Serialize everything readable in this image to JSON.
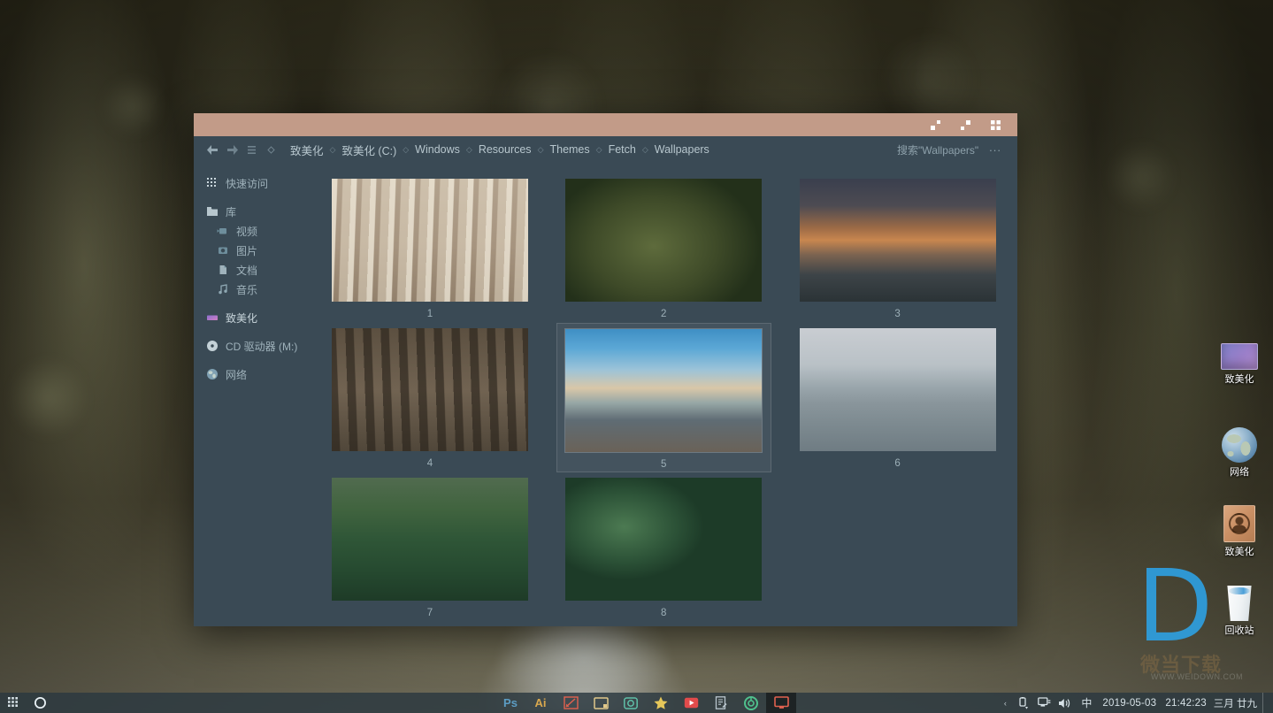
{
  "window": {
    "titlebar_buttons": [
      {
        "name": "minimize-button",
        "icon": "minimize-icon"
      },
      {
        "name": "maximize-button",
        "icon": "maximize-icon"
      },
      {
        "name": "close-button",
        "icon": "grid-close-icon"
      }
    ],
    "nav": {
      "back": "back-arrow-icon",
      "forward": "forward-arrow-icon",
      "recent": "recent-locations-icon",
      "up": "up-chevron-icon"
    },
    "breadcrumbs": [
      "致美化",
      "致美化 (C:)",
      "Windows",
      "Resources",
      "Themes",
      "Fetch",
      "Wallpapers"
    ],
    "breadcrumb_separator": "◇",
    "search_placeholder": "搜索\"Wallpapers\"",
    "overflow_label": "..."
  },
  "sidebar": {
    "items": [
      {
        "label": "快速访问",
        "icon": "quick-access-icon",
        "level": 0,
        "accent": false
      },
      {
        "label": "库",
        "icon": "library-folder-icon",
        "level": 0,
        "accent": false
      },
      {
        "label": "视频",
        "icon": "video-icon",
        "level": 1,
        "accent": false
      },
      {
        "label": "图片",
        "icon": "pictures-icon",
        "level": 1,
        "accent": false
      },
      {
        "label": "文档",
        "icon": "documents-icon",
        "level": 1,
        "accent": false
      },
      {
        "label": "音乐",
        "icon": "music-icon",
        "level": 1,
        "accent": false
      },
      {
        "label": "致美化",
        "icon": "this-pc-icon",
        "level": 0,
        "accent": true
      },
      {
        "label": "CD 驱动器 (M:)",
        "icon": "cd-drive-icon",
        "level": 0,
        "accent": false
      },
      {
        "label": "网络",
        "icon": "network-globe-icon",
        "level": 0,
        "accent": false
      }
    ]
  },
  "files": [
    {
      "label": "1",
      "art": "t1",
      "selected": false
    },
    {
      "label": "2",
      "art": "t2",
      "selected": false
    },
    {
      "label": "3",
      "art": "t3",
      "selected": false
    },
    {
      "label": "4",
      "art": "t4",
      "selected": false
    },
    {
      "label": "5",
      "art": "t5",
      "selected": true
    },
    {
      "label": "6",
      "art": "t6",
      "selected": false
    },
    {
      "label": "7",
      "art": "t7",
      "selected": false
    },
    {
      "label": "8",
      "art": "t8",
      "selected": false
    }
  ],
  "desktop_icons": [
    {
      "label": "致美化",
      "icon": "purple-folder-icon"
    },
    {
      "label": "网络",
      "icon": "network-globe-icon"
    },
    {
      "label": "致美化",
      "icon": "user-folder-icon"
    },
    {
      "label": "回收站",
      "icon": "recycle-bin-icon"
    }
  ],
  "watermark": {
    "logo": "D",
    "text": "微当下载",
    "url": "WWW.WEIDOWN.COM"
  },
  "taskbar": {
    "start_icon": "start-grid-icon",
    "cortana_icon": "cortana-circle-icon",
    "apps": [
      {
        "name": "photoshop",
        "label": "Ps",
        "color": "#5c9dc4",
        "active": false
      },
      {
        "name": "illustrator",
        "label": "Ai",
        "color": "#d9a84e",
        "active": false
      },
      {
        "name": "snipping-tool",
        "label": "",
        "color": "#e0614f",
        "active": false
      },
      {
        "name": "window-manager",
        "label": "",
        "color": "#e0c88a",
        "active": false
      },
      {
        "name": "camera-app",
        "label": "",
        "color": "#5fbfa8",
        "active": false
      },
      {
        "name": "favorites-star",
        "label": "",
        "color": "#e6c75a",
        "active": false
      },
      {
        "name": "media-player",
        "label": "",
        "color": "#e14b4b",
        "active": false
      },
      {
        "name": "notes-editor",
        "label": "",
        "color": "#b9c6ce",
        "active": false
      },
      {
        "name": "chrome-browser",
        "label": "",
        "color": "#4fc08d",
        "active": false
      },
      {
        "name": "file-explorer",
        "label": "",
        "color": "#e0614f",
        "active": true
      }
    ],
    "tray": {
      "overflow": "‹",
      "usb_icon": "usb-eject-icon",
      "network_icon": "network-monitor-icon",
      "volume_icon": "volume-icon",
      "ime": "中",
      "date": "2019-05-03",
      "time": "21:42:23",
      "lunar": "三月 廿九"
    }
  },
  "colors": {
    "titlebar": "#c29b88",
    "window_bg": "#3a4a55",
    "taskbar": "#2b3840",
    "accent_text": "#b7c6cd",
    "watermark_blue": "#2e9fe0"
  }
}
